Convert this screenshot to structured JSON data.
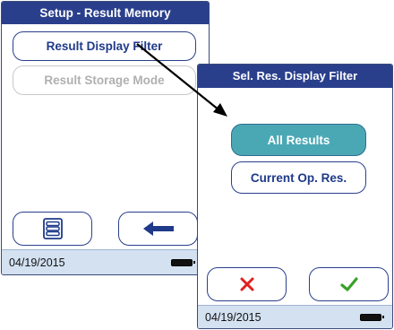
{
  "screen1": {
    "title": "Setup - Result Memory",
    "buttons": {
      "display_filter": "Result Display Filter",
      "storage_mode": "Result Storage Mode"
    },
    "icons": {
      "menu": "list-menu-icon",
      "back": "back-arrow-icon"
    },
    "status": {
      "date": "04/19/2015",
      "battery": "battery-full-icon"
    }
  },
  "screen2": {
    "title": "Sel. Res. Display Filter",
    "options": {
      "all": "All Results",
      "current": "Current Op. Res."
    },
    "selected_option": "All Results",
    "icons": {
      "cancel": "cancel-x-icon",
      "confirm": "checkmark-icon"
    },
    "status": {
      "date": "04/19/2015",
      "battery": "battery-full-icon"
    }
  },
  "colors": {
    "title_bar": "#2a3f8c",
    "button_text": "#1f3a8a",
    "selected": "#4aa8b5",
    "status_bar": "#d3e1f1",
    "cancel": "#e02020",
    "confirm": "#3aa02a"
  }
}
